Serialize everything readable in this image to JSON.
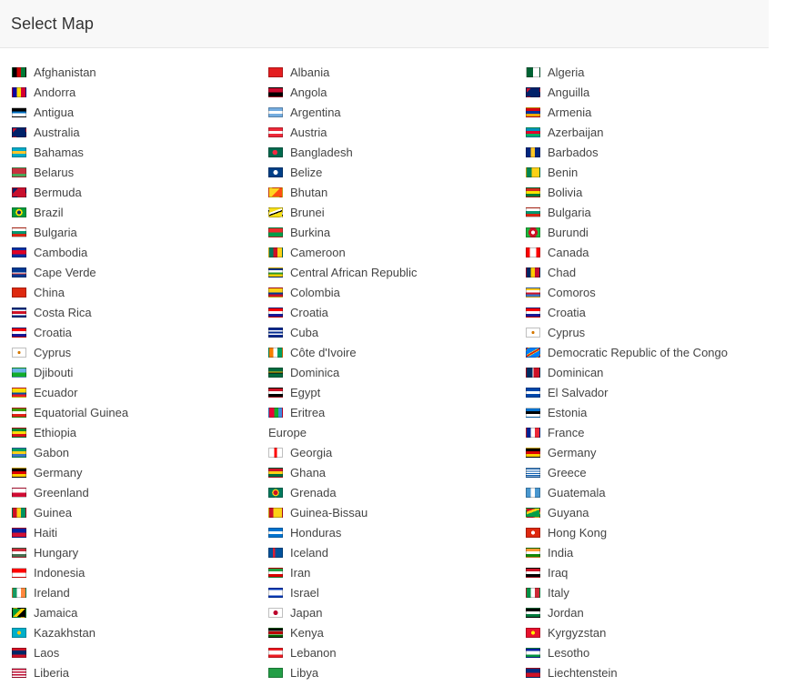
{
  "header": {
    "title": "Select Map"
  },
  "columns": [
    [
      {
        "name": "Afghanistan",
        "flag": "linear-gradient(90deg,#000 0 33%,#c00 33% 66%,#007a36 66%)"
      },
      {
        "name": "Andorra",
        "flag": "linear-gradient(90deg,#10069f 0 33%,#fedd00 33% 66%,#d50032 66%)"
      },
      {
        "name": "Antigua",
        "flag": "linear-gradient(180deg,#000 0 40%,#0072c6 40% 60%,#fff 60%)"
      },
      {
        "name": "Australia",
        "flag": "linear-gradient(135deg,#c8102e 0 20%,#012169 20%)"
      },
      {
        "name": "Bahamas",
        "flag": "linear-gradient(180deg,#00abc9 0 33%,#ffc72c 33% 66%,#00abc9 66%)"
      },
      {
        "name": "Belarus",
        "flag": "linear-gradient(180deg,#c8313e 0 66%,#4aa657 66%)"
      },
      {
        "name": "Bermuda",
        "flag": "linear-gradient(135deg,#012169 0 25%,#c8102e 25%)"
      },
      {
        "name": "Brazil",
        "flag": "radial-gradient(circle,#002776 0 25%,#ffdf00 26% 45%,#009c3b 46%)"
      },
      {
        "name": "Bulgaria",
        "flag": "linear-gradient(180deg,#fff 0 33%,#00966e 33% 66%,#d62612 66%)"
      },
      {
        "name": "Cambodia",
        "flag": "linear-gradient(180deg,#032ea1 0 25%,#e00025 25% 75%,#032ea1 75%)"
      },
      {
        "name": "Cape Verde",
        "flag": "linear-gradient(180deg,#003893 0 50%,#fff 50% 60%,#cf2027 60% 70%,#003893 70%)"
      },
      {
        "name": "China",
        "flag": "linear-gradient(180deg,#de2910 0 100%)"
      },
      {
        "name": "Costa Rica",
        "flag": "linear-gradient(180deg,#002b7f 0 17%,#fff 17% 33%,#ce1126 33% 67%,#fff 67% 83%,#002b7f 83%)"
      },
      {
        "name": "Croatia",
        "flag": "linear-gradient(180deg,#ff0000 0 33%,#fff 33% 66%,#171796 66%)"
      },
      {
        "name": "Cyprus",
        "flag": "radial-gradient(circle,#d57800 0 20%,#fff 21%)"
      },
      {
        "name": "Djibouti",
        "flag": "linear-gradient(180deg,#6ab2e7 0 50%,#12ad2b 50%)"
      },
      {
        "name": "Ecuador",
        "flag": "linear-gradient(180deg,#ffdd00 0 50%,#034ea2 50% 75%,#ed1c24 75%)"
      },
      {
        "name": "Equatorial Guinea",
        "flag": "linear-gradient(180deg,#3e9a00 0 33%,#fff 33% 66%,#e32118 66%)"
      },
      {
        "name": "Ethiopia",
        "flag": "linear-gradient(180deg,#078930 0 33%,#fcdd09 33% 66%,#da121a 66%)"
      },
      {
        "name": "Gabon",
        "flag": "linear-gradient(180deg,#009e60 0 33%,#fcd116 33% 66%,#3a75c4 66%)"
      },
      {
        "name": "Germany",
        "flag": "linear-gradient(180deg,#000 0 33%,#dd0000 33% 66%,#ffce00 66%)"
      },
      {
        "name": "Greenland",
        "flag": "linear-gradient(180deg,#fff 0 50%,#d00c33 50%)"
      },
      {
        "name": "Guinea",
        "flag": "linear-gradient(90deg,#ce1126 0 33%,#fcd116 33% 66%,#009460 66%)"
      },
      {
        "name": "Haiti",
        "flag": "linear-gradient(180deg,#00209f 0 50%,#d21034 50%)"
      },
      {
        "name": "Hungary",
        "flag": "linear-gradient(180deg,#ce2939 0 33%,#fff 33% 66%,#477050 66%)"
      },
      {
        "name": "Indonesia",
        "flag": "linear-gradient(180deg,#ff0000 0 50%,#fff 50%)"
      },
      {
        "name": "Ireland",
        "flag": "linear-gradient(90deg,#169b62 0 33%,#fff 33% 66%,#ff883e 66%)"
      },
      {
        "name": "Jamaica",
        "flag": "linear-gradient(135deg,#009b3a 0 40%,#fed100 40% 60%,#000 60%)"
      },
      {
        "name": "Kazakhstan",
        "flag": "radial-gradient(circle,#fec50c 0 25%,#00afca 26%)"
      },
      {
        "name": "Laos",
        "flag": "linear-gradient(180deg,#ce1126 0 25%,#002868 25% 75%,#ce1126 75%)"
      },
      {
        "name": "Liberia",
        "flag": "repeating-linear-gradient(180deg,#bf0a30 0 1.5px,#fff 1.5px 3px)"
      }
    ],
    [
      {
        "name": "Albania",
        "flag": "linear-gradient(180deg,#e41e20 0 100%)"
      },
      {
        "name": "Angola",
        "flag": "linear-gradient(180deg,#cc092f 0 50%,#000 50%)"
      },
      {
        "name": "Argentina",
        "flag": "linear-gradient(180deg,#74acdf 0 33%,#fff 33% 66%,#74acdf 66%)"
      },
      {
        "name": "Austria",
        "flag": "linear-gradient(180deg,#ed2939 0 33%,#fff 33% 66%,#ed2939 66%)"
      },
      {
        "name": "Bangladesh",
        "flag": "radial-gradient(circle at 45% 50%,#f42a41 0 30%,#006a4e 31%)"
      },
      {
        "name": "Belize",
        "flag": "radial-gradient(circle,#fff 0 30%,#003f87 31%)"
      },
      {
        "name": "Bhutan",
        "flag": "linear-gradient(135deg,#ffd520 0 50%,#ff4e12 50%)"
      },
      {
        "name": "Brunei",
        "flag": "linear-gradient(160deg,#f7e017 0 35%,#fff 35% 50%,#000 50% 60%,#f7e017 60%)"
      },
      {
        "name": "Burkina",
        "flag": "linear-gradient(180deg,#ef2b2d 0 50%,#009e49 50%)"
      },
      {
        "name": "Cameroon",
        "flag": "linear-gradient(90deg,#007a5e 0 33%,#ce1126 33% 66%,#fcd116 66%)"
      },
      {
        "name": "Central African Republic",
        "flag": "linear-gradient(180deg,#003082 0 25%,#fff 25% 50%,#289728 50% 75%,#ffce00 75%)"
      },
      {
        "name": "Colombia",
        "flag": "linear-gradient(180deg,#fcd116 0 50%,#003893 50% 75%,#ce1126 75%)"
      },
      {
        "name": "Croatia",
        "flag": "linear-gradient(180deg,#ff0000 0 33%,#fff 33% 66%,#171796 66%)"
      },
      {
        "name": "Cuba",
        "flag": "linear-gradient(180deg,#002a8f 0 20%,#fff 20% 40%,#002a8f 40% 60%,#fff 60% 80%,#002a8f 80%)"
      },
      {
        "name": "Côte d'Ivoire",
        "flag": "linear-gradient(90deg,#f77f00 0 33%,#fff 33% 66%,#009e60 66%)"
      },
      {
        "name": "Dominica",
        "flag": "linear-gradient(180deg,#006b3f 0 40%,#fcd116 40% 50%,#000 50% 60%,#006b3f 60%)"
      },
      {
        "name": "Egypt",
        "flag": "linear-gradient(180deg,#ce1126 0 33%,#fff 33% 66%,#000 66%)"
      },
      {
        "name": "Eritrea",
        "flag": "linear-gradient(90deg,#ea0437 0 40%,#12ad2b 40% 70%,#4189dd 70%)"
      },
      {
        "name": "Europe",
        "flag": ""
      },
      {
        "name": "Georgia",
        "flag": "linear-gradient(90deg,#fff 0 40%,#ff0000 40% 60%,#fff 60%)"
      },
      {
        "name": "Ghana",
        "flag": "linear-gradient(180deg,#ce1126 0 33%,#fcd116 33% 66%,#006b3f 66%)"
      },
      {
        "name": "Grenada",
        "flag": "radial-gradient(circle,#ce1126 0 30%,#fcd116 31% 45%,#007a5e 46%)"
      },
      {
        "name": "Guinea-Bissau",
        "flag": "linear-gradient(90deg,#ce1126 0 33%,#fcd116 33%)"
      },
      {
        "name": "Honduras",
        "flag": "linear-gradient(180deg,#0073cf 0 33%,#fff 33% 66%,#0073cf 66%)"
      },
      {
        "name": "Iceland",
        "flag": "linear-gradient(90deg,#02529c 0 30%,#dc1e35 30% 45%,#02529c 45%)"
      },
      {
        "name": "Iran",
        "flag": "linear-gradient(180deg,#239f40 0 33%,#fff 33% 66%,#da0000 66%)"
      },
      {
        "name": "Israel",
        "flag": "linear-gradient(180deg,#0038b8 0 15%,#fff 15% 85%,#0038b8 85%)"
      },
      {
        "name": "Japan",
        "flag": "radial-gradient(circle,#bc002d 0 30%,#fff 31%)"
      },
      {
        "name": "Kenya",
        "flag": "linear-gradient(180deg,#000 0 30%,#fff 30% 35%,#bb0000 35% 65%,#fff 65% 70%,#006600 70%)"
      },
      {
        "name": "Lebanon",
        "flag": "linear-gradient(180deg,#ed1c24 0 25%,#fff 25% 75%,#ed1c24 75%)"
      },
      {
        "name": "Libya",
        "flag": "linear-gradient(180deg,#239e46 0 100%)"
      }
    ],
    [
      {
        "name": "Algeria",
        "flag": "linear-gradient(90deg,#006233 0 50%,#fff 50%)"
      },
      {
        "name": "Anguilla",
        "flag": "linear-gradient(135deg,#c8102e 0 20%,#012169 20%)"
      },
      {
        "name": "Armenia",
        "flag": "linear-gradient(180deg,#d90012 0 33%,#0033a0 33% 66%,#f2a800 66%)"
      },
      {
        "name": "Azerbaijan",
        "flag": "linear-gradient(180deg,#0092bc 0 33%,#e4002b 33% 66%,#00af66 66%)"
      },
      {
        "name": "Barbados",
        "flag": "linear-gradient(90deg,#00267f 0 33%,#ffc726 33% 66%,#00267f 66%)"
      },
      {
        "name": "Benin",
        "flag": "linear-gradient(90deg,#008751 0 40%,#fcd116 40%)"
      },
      {
        "name": "Bolivia",
        "flag": "linear-gradient(180deg,#d52b1e 0 33%,#f9e300 33% 66%,#007934 66%)"
      },
      {
        "name": "Bulgaria",
        "flag": "linear-gradient(180deg,#fff 0 33%,#00966e 33% 66%,#d62612 66%)"
      },
      {
        "name": "Burundi",
        "flag": "radial-gradient(circle,#fff 0 25%,#ce1126 26% 60%,#1eb53a 61%)"
      },
      {
        "name": "Canada",
        "flag": "linear-gradient(90deg,#ff0000 0 25%,#fff 25% 75%,#ff0000 75%)"
      },
      {
        "name": "Chad",
        "flag": "linear-gradient(90deg,#002664 0 33%,#fecb00 33% 66%,#c60c30 66%)"
      },
      {
        "name": "Comoros",
        "flag": "linear-gradient(180deg,#ffc61e 0 25%,#fff 25% 50%,#ce1126 50% 75%,#3a75c4 75%)"
      },
      {
        "name": "Croatia",
        "flag": "linear-gradient(180deg,#ff0000 0 33%,#fff 33% 66%,#171796 66%)"
      },
      {
        "name": "Cyprus",
        "flag": "radial-gradient(circle,#d57800 0 20%,#fff 21%)"
      },
      {
        "name": "Democratic Republic of the Congo",
        "flag": "linear-gradient(150deg,#007fff 0 40%,#f7d618 40% 45%,#ce1021 45% 55%,#f7d618 55% 60%,#007fff 60%)"
      },
      {
        "name": "Dominican",
        "flag": "linear-gradient(90deg,#002d62 0 45%,#fff 45% 55%,#ce1126 55%)"
      },
      {
        "name": "El Salvador",
        "flag": "linear-gradient(180deg,#0047ab 0 33%,#fff 33% 66%,#0047ab 66%)"
      },
      {
        "name": "Estonia",
        "flag": "linear-gradient(180deg,#0072ce 0 33%,#000 33% 66%,#fff 66%)"
      },
      {
        "name": "France",
        "flag": "linear-gradient(90deg,#002395 0 33%,#fff 33% 66%,#ed2939 66%)"
      },
      {
        "name": "Germany",
        "flag": "linear-gradient(180deg,#000 0 33%,#dd0000 33% 66%,#ffce00 66%)"
      },
      {
        "name": "Greece",
        "flag": "repeating-linear-gradient(180deg,#0d5eaf 0 1.2px,#fff 1.2px 2.4px)"
      },
      {
        "name": "Guatemala",
        "flag": "linear-gradient(90deg,#4997d0 0 33%,#fff 33% 66%,#4997d0 66%)"
      },
      {
        "name": "Guyana",
        "flag": "linear-gradient(160deg,#ce1126 0 25%,#fcd116 25% 45%,#009e49 45%)"
      },
      {
        "name": "Hong Kong",
        "flag": "radial-gradient(circle,#fff 0 25%,#de2910 26%)"
      },
      {
        "name": "India",
        "flag": "linear-gradient(180deg,#ff9933 0 33%,#fff 33% 66%,#138808 66%)"
      },
      {
        "name": "Iraq",
        "flag": "linear-gradient(180deg,#ce1126 0 33%,#fff 33% 66%,#000 66%)"
      },
      {
        "name": "Italy",
        "flag": "linear-gradient(90deg,#009246 0 33%,#fff 33% 66%,#ce2b37 66%)"
      },
      {
        "name": "Jordan",
        "flag": "linear-gradient(180deg,#000 0 33%,#fff 33% 66%,#007a3d 66%)"
      },
      {
        "name": "Kyrgyzstan",
        "flag": "radial-gradient(circle,#ffef00 0 25%,#e8112d 26%)"
      },
      {
        "name": "Lesotho",
        "flag": "linear-gradient(180deg,#00209f 0 30%,#fff 30% 70%,#009543 70%)"
      },
      {
        "name": "Liechtenstein",
        "flag": "linear-gradient(180deg,#002b7f 0 50%,#ce1126 50%)"
      }
    ]
  ]
}
